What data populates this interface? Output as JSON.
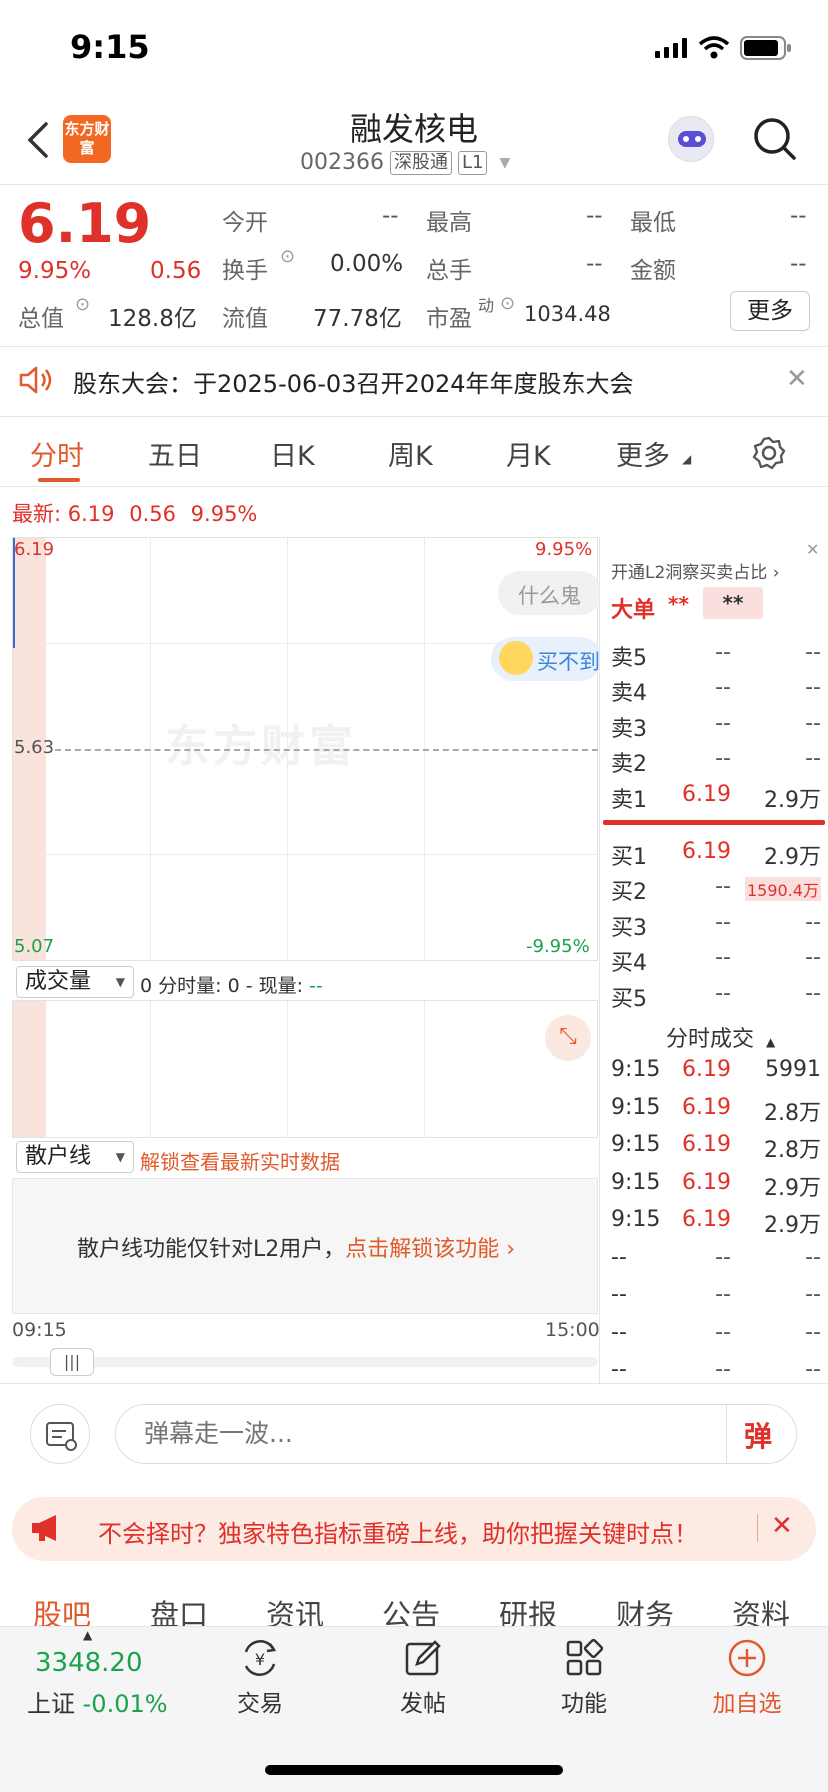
{
  "status_bar": {
    "time": "9:15"
  },
  "header": {
    "logo_text": "东方财富",
    "stock_name": "融发核电",
    "stock_code": "002366",
    "tag_connect": "深股通",
    "tag_level": "L1"
  },
  "quote": {
    "price": "6.19",
    "change_pct": "9.95%",
    "change": "0.56",
    "open_label": "今开",
    "open_value": "--",
    "high_label": "最高",
    "high_value": "--",
    "low_label": "最低",
    "low_value": "--",
    "turnover_label": "换手",
    "turnover_value": "0.00%",
    "total_hand_label": "总手",
    "total_hand_value": "--",
    "amount_label": "金额",
    "amount_value": "--",
    "mktcap_label": "总值",
    "mktcap_value": "128.8亿",
    "float_label": "流值",
    "float_value": "77.78亿",
    "pe_label": "市盈",
    "pe_sup": "动",
    "pe_value": "1034.48",
    "more_label": "更多"
  },
  "notice": {
    "text": "股东大会：于2025-06-03召开2024年年度股东大会"
  },
  "tabs": [
    "分时",
    "五日",
    "日K",
    "周K",
    "月K",
    "更多"
  ],
  "chart": {
    "latest_label": "最新:",
    "latest_price": "6.19",
    "latest_change": "0.56",
    "latest_pct": "9.95%",
    "y_top": "6.19",
    "y_mid": "5.63",
    "y_bottom": "5.07",
    "pct_top": "9.95%",
    "pct_bottom": "-9.95%",
    "watermark": "东方财富",
    "bubble_1": "什么鬼",
    "bubble_2": "买不到"
  },
  "volume": {
    "selector": "成交量",
    "info_prefix": "0 分时量: 0 - 现量:",
    "info_value": "--"
  },
  "retail": {
    "selector": "散户线",
    "unlock_hint": "解锁查看最新实时数据",
    "panel_text": "散户线功能仅针对L2用户，",
    "panel_link": "点击解锁该功能",
    "time_start": "09:15",
    "time_end": "15:00"
  },
  "order_book": {
    "l2_hint": "开通L2洞察买卖占比",
    "big_order_label": "大单",
    "big_order_v1": "**",
    "big_order_v2": "**",
    "sell": [
      {
        "label": "卖5",
        "price": "--",
        "vol": "--"
      },
      {
        "label": "卖4",
        "price": "--",
        "vol": "--"
      },
      {
        "label": "卖3",
        "price": "--",
        "vol": "--"
      },
      {
        "label": "卖2",
        "price": "--",
        "vol": "--"
      },
      {
        "label": "卖1",
        "price": "6.19",
        "vol": "2.9万"
      }
    ],
    "buy": [
      {
        "label": "买1",
        "price": "6.19",
        "vol": "2.9万"
      },
      {
        "label": "买2",
        "price": "--",
        "vol": "1590.4万"
      },
      {
        "label": "买3",
        "price": "--",
        "vol": "--"
      },
      {
        "label": "买4",
        "price": "--",
        "vol": "--"
      },
      {
        "label": "买5",
        "price": "--",
        "vol": "--"
      }
    ]
  },
  "trades": {
    "title": "分时成交",
    "rows": [
      {
        "t": "9:15",
        "p": "6.19",
        "v": "5991"
      },
      {
        "t": "9:15",
        "p": "6.19",
        "v": "2.8万"
      },
      {
        "t": "9:15",
        "p": "6.19",
        "v": "2.8万"
      },
      {
        "t": "9:15",
        "p": "6.19",
        "v": "2.9万"
      },
      {
        "t": "9:15",
        "p": "6.19",
        "v": "2.9万"
      },
      {
        "t": "--",
        "p": "--",
        "v": "--"
      },
      {
        "t": "--",
        "p": "--",
        "v": "--"
      },
      {
        "t": "--",
        "p": "--",
        "v": "--"
      },
      {
        "t": "--",
        "p": "--",
        "v": "--"
      }
    ]
  },
  "comment": {
    "placeholder": "弹幕走一波...",
    "danmu_label": "弹"
  },
  "promo": {
    "text": "不会择时？独家特色指标重磅上线，助你把握关键时点！"
  },
  "bottom_tabs": [
    "股吧",
    "盘口",
    "资讯",
    "公告",
    "研报",
    "财务",
    "资料"
  ],
  "bottom_nav": {
    "index_value": "3348.20",
    "index_name": "上证",
    "index_change": "-0.01%",
    "trade": "交易",
    "post": "发帖",
    "function": "功能",
    "add_watch": "加自选"
  },
  "colors": {
    "up": "#e0302a",
    "down": "#1aa34a",
    "accent": "#e05a2b"
  }
}
